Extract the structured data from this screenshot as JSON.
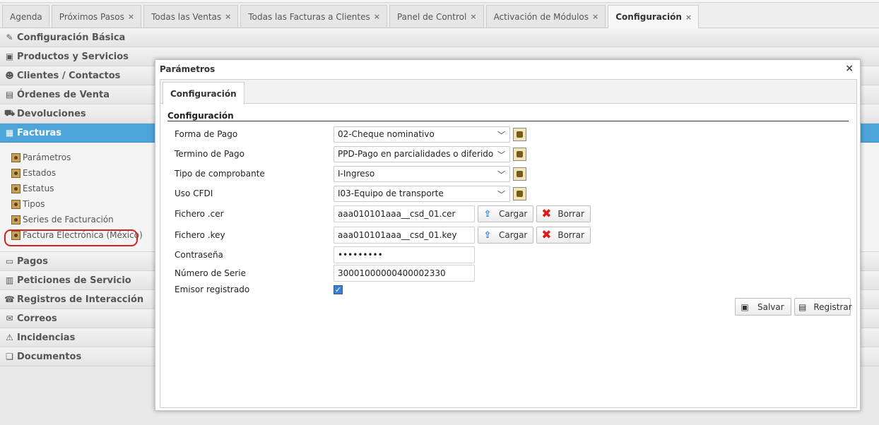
{
  "tabs": [
    {
      "label": "Agenda",
      "closable": false
    },
    {
      "label": "Próximos Pasos",
      "closable": true
    },
    {
      "label": "Todas las Ventas",
      "closable": true
    },
    {
      "label": "Todas las Facturas a Clientes",
      "closable": true
    },
    {
      "label": "Panel de Control",
      "closable": true
    },
    {
      "label": "Activación de Módulos",
      "closable": true
    },
    {
      "label": "Configuración",
      "closable": true,
      "active": true
    }
  ],
  "tab_close_glyph": "×",
  "menu": {
    "items": [
      {
        "label": "Configuración Básica",
        "icon": "wrench-icon"
      },
      {
        "label": "Productos y Servicios",
        "icon": "box-icon"
      },
      {
        "label": "Clientes / Contactos",
        "icon": "user-icon"
      },
      {
        "label": "Órdenes de Venta",
        "icon": "order-icon"
      },
      {
        "label": "Devoluciones",
        "icon": "cart-icon"
      },
      {
        "label": "Facturas",
        "icon": "invoice-icon",
        "active": true
      },
      {
        "label": "Pagos",
        "icon": "payment-icon"
      },
      {
        "label": "Peticiones de Servicio",
        "icon": "service-icon"
      },
      {
        "label": "Registros de Interacción",
        "icon": "phone-icon"
      },
      {
        "label": "Correos",
        "icon": "mail-icon"
      },
      {
        "label": "Incidencias",
        "icon": "incident-icon"
      },
      {
        "label": "Documentos",
        "icon": "documents-icon"
      }
    ],
    "facturas_submenu": [
      "Parámetros",
      "Estados",
      "Estatus",
      "Tipos",
      "Series de Facturación",
      "Factura Electrónica (México)"
    ]
  },
  "dialog": {
    "title": "Parámetros",
    "close": "×",
    "tab": "Configuración",
    "section_title": "Configuración",
    "fields": {
      "forma_pago": {
        "label": "Forma de Pago",
        "value": "02-Cheque nominativo"
      },
      "termino_pago": {
        "label": "Termino de Pago",
        "value": "PPD-Pago en parcialidades o diferido"
      },
      "tipo_comprobante": {
        "label": "Tipo de comprobante",
        "value": "I-Ingreso"
      },
      "uso_cfdi": {
        "label": "Uso CFDI",
        "value": "I03-Equipo de transporte"
      },
      "fichero_cer": {
        "label": "Fichero .cer",
        "value": "aaa010101aaa__csd_01.cer"
      },
      "fichero_key": {
        "label": "Fichero .key",
        "value": "aaa010101aaa__csd_01.key"
      },
      "contrasena": {
        "label": "Contraseña",
        "value": "•••••••••"
      },
      "numero_serie": {
        "label": "Número de Serie",
        "value": "30001000000400002330"
      },
      "emisor_registrado": {
        "label": "Emisor registrado",
        "checked": true
      }
    },
    "buttons": {
      "cargar": "Cargar",
      "borrar": "Borrar",
      "salvar": "Salvar",
      "registrar": "Registrar"
    }
  }
}
